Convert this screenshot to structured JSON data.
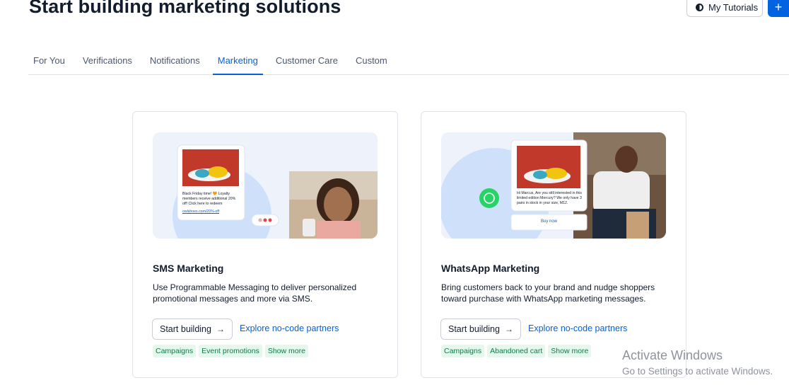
{
  "header": {
    "title": "Start building marketing solutions",
    "tutorials_label": "My Tutorials",
    "tutorials_icon": "contrast-icon",
    "add_label": "+"
  },
  "tabs": [
    {
      "label": "For You",
      "active": false
    },
    {
      "label": "Verifications",
      "active": false
    },
    {
      "label": "Notifications",
      "active": false
    },
    {
      "label": "Marketing",
      "active": true
    },
    {
      "label": "Customer Care",
      "active": false
    },
    {
      "label": "Custom",
      "active": false
    }
  ],
  "cards": [
    {
      "title": "SMS Marketing",
      "description": "Use Programmable Messaging to deliver personalized promotional messages and more via SMS.",
      "start_label": "Start building",
      "explore_label": "Explore no-code partners",
      "tags": [
        "Campaigns",
        "Event promotions"
      ],
      "more_label": "Show more",
      "hero": {
        "message": "Black Friday time! 🧡 Loyalty members receive additional 20% off! Click here to redeem",
        "link": "owlshoes.com/20%-off"
      }
    },
    {
      "title": "WhatsApp Marketing",
      "description": "Bring customers back to your brand and nudge shoppers toward purchase with WhatsApp marketing messages.",
      "start_label": "Start building",
      "explore_label": "Explore no-code partners",
      "tags": [
        "Campaigns",
        "Abandoned cart"
      ],
      "more_label": "Show more",
      "hero": {
        "message": "Hi Marcus, Are you still interested in this limited edition Mercury? We only have 3 pairs in stock in your size, M12.",
        "button": "Buy now"
      }
    }
  ],
  "watermark": {
    "line1": "Activate Windows",
    "line2": "Go to Settings to activate Windows."
  },
  "colors": {
    "accent": "#0263e0",
    "tag_text": "#0e7c45",
    "tag_bg": "#e6f7ee",
    "whatsapp": "#25d366"
  }
}
